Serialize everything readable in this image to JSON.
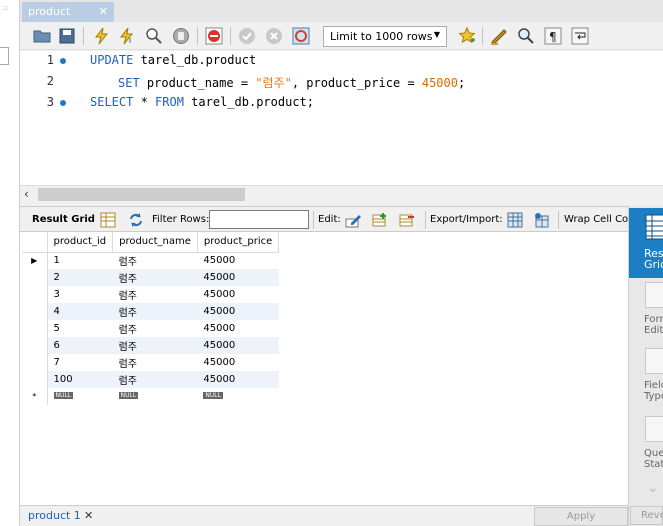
{
  "tab": {
    "title": "product",
    "close": "✕"
  },
  "toolbar": {
    "limit_select": "Limit to 1000 rows"
  },
  "editor": {
    "lines": [
      {
        "num": "1",
        "kw1": "UPDATE",
        "rest": " tarel_db.product"
      },
      {
        "num": "2",
        "kw1": "SET",
        "p1": " product_name = ",
        "str": "\"럼주\"",
        "p2": ", product_price = ",
        "num_val": "45000",
        "p3": ";"
      },
      {
        "num": "3",
        "kw1": "SELECT",
        "p1": " * ",
        "kw2": "FROM",
        "rest": " tarel_db.product;"
      }
    ]
  },
  "result_toolbar": {
    "result_grid": "Result Grid",
    "filter_rows": "Filter Rows:",
    "filter_value": "",
    "edit": "Edit:",
    "export_import": "Export/Import:",
    "wrap": "Wrap Cell Con"
  },
  "grid": {
    "columns": [
      "product_id",
      "product_name",
      "product_price"
    ],
    "rows": [
      [
        "1",
        "럼주",
        "45000"
      ],
      [
        "2",
        "럼주",
        "45000"
      ],
      [
        "3",
        "럼주",
        "45000"
      ],
      [
        "4",
        "럼주",
        "45000"
      ],
      [
        "5",
        "럼주",
        "45000"
      ],
      [
        "6",
        "럼주",
        "45000"
      ],
      [
        "7",
        "럼주",
        "45000"
      ],
      [
        "100",
        "럼주",
        "45000"
      ]
    ],
    "null_label": "NULL",
    "current_marker": "▶",
    "new_marker": "*"
  },
  "side_panel": {
    "result_grid": [
      "Resu",
      "Grid"
    ],
    "form_editor": [
      "Form",
      "Edito"
    ],
    "field_types": [
      "Field",
      "Type"
    ],
    "query_stats": [
      "Quer",
      "Stati"
    ]
  },
  "bottom": {
    "tab": "product 1",
    "close": "✕",
    "apply": "Apply",
    "revert": "Rever"
  }
}
